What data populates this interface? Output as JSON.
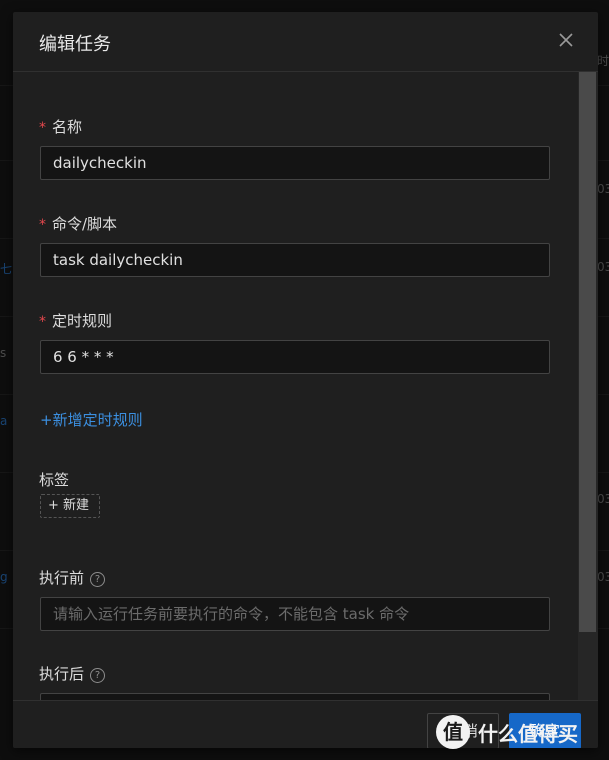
{
  "background": {
    "header_fragment": "时",
    "time_fragments": [
      "03",
      "03",
      "03",
      "03"
    ],
    "link_fragments": [
      "七",
      "a",
      "g"
    ],
    "text_fragments": [
      "s"
    ]
  },
  "modal": {
    "title": "编辑任务",
    "fields": {
      "name": {
        "required_mark": "*",
        "label": "名称",
        "value": "dailycheckin"
      },
      "command": {
        "required_mark": "*",
        "label": "命令/脚本",
        "value": "task dailycheckin"
      },
      "schedule": {
        "required_mark": "*",
        "label": "定时规则",
        "value": "6 6 * * *"
      },
      "add_rule": "+新增定时规则",
      "tags": {
        "label": "标签",
        "new_button": "+ 新建"
      },
      "before": {
        "label": "执行前",
        "placeholder": "请输入运行任务前要执行的命令，不能包含 task 命令"
      },
      "after": {
        "label": "执行后"
      }
    },
    "footer": {
      "cancel": "取消",
      "ok": "确定"
    }
  },
  "watermark": {
    "logo": "值",
    "text": "什么值得买"
  },
  "icons": {
    "close": "close-icon",
    "help": "question-circle-icon"
  }
}
